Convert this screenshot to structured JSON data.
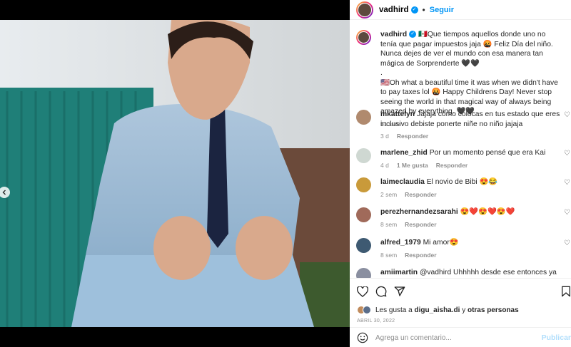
{
  "post": {
    "username": "vadhird",
    "separator": "•",
    "follow_label": "Seguir",
    "caption": {
      "line_es": "🇲🇽Que tiempos aquellos donde uno no tenía que pagar impuestos jaja 🤬 Feliz Día del niño. Nunca dejes de ver el mundo con esa manera tan mágica de Sorprenderte 🖤🖤",
      "line_mid": ".",
      "line_en": "🇺🇸Oh what a beautiful time it was when we didn't have to pay taxes lol 🤬 Happy Childrens Day! Never stop seeing the world in that magical way of always being amazed by everything. 🖤🖤",
      "time": "51 sem"
    }
  },
  "comments": [
    {
      "username": "mkattelyn",
      "text": "Jajaja cómo colocas en tus estado que eres inclusivo debiste ponerte niñe no niño jajaja",
      "time": "3 d",
      "likes": "",
      "reply": "Responder"
    },
    {
      "username": "marlene_zhid",
      "text": "Por un momento pensé que era Kai",
      "time": "4 d",
      "likes": "1 Me gusta",
      "reply": "Responder"
    },
    {
      "username": "laimeclaudia",
      "text": "El novio de Bibi 😍😂",
      "time": "2 sem",
      "likes": "",
      "reply": "Responder"
    },
    {
      "username": "perezhernandezsarahi",
      "text": "😍❤️😍❤️😍❤️",
      "time": "8 sem",
      "likes": "",
      "reply": "Responder"
    },
    {
      "username": "alfred_1979",
      "text": "Mi amor😍",
      "time": "8 sem",
      "likes": "",
      "reply": "Responder"
    },
    {
      "username": "amiimartin",
      "text": "@vadhird Uhhhhh desde ese entonces ya eras mi",
      "time": "",
      "likes": "",
      "reply": ""
    }
  ],
  "actions": {
    "likes_prefix": "Les gusta a",
    "likes_user": "digu_aisha.di",
    "likes_suffix": "y",
    "likes_others": "otras personas",
    "date": "ABRIL 30, 2022",
    "comment_placeholder": "Agrega un comentario...",
    "publish_label": "Publicar"
  },
  "colors": {
    "accent": "#0095f6",
    "like": "#ed4956"
  },
  "icons": [
    "verified-badge-icon",
    "heart-icon",
    "comment-icon",
    "share-icon",
    "bookmark-icon",
    "emoji-icon",
    "chevron-left-icon"
  ]
}
